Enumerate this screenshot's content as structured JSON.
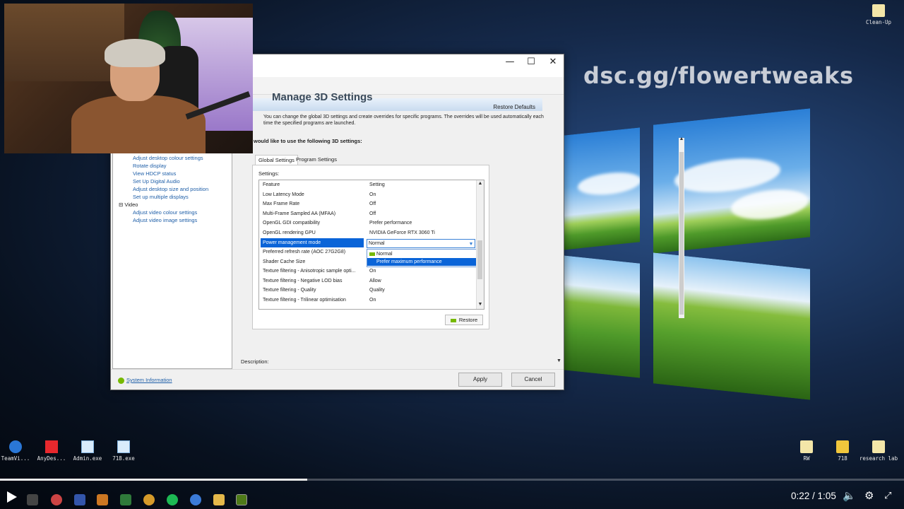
{
  "overlay": {
    "watermark": "dsc.gg/flowertweaks"
  },
  "window": {
    "accent": "#76b900"
  },
  "tree": {
    "items": [
      "Adjust desktop colour settings",
      "Rotate display",
      "View HDCP status",
      "Set Up Digital Audio",
      "Adjust desktop size and position",
      "Set up multiple displays",
      "Adjust video colour settings",
      "Adjust video image settings"
    ],
    "group_video": "Video"
  },
  "main": {
    "title": "Manage 3D Settings",
    "restore_defaults": "Restore Defaults",
    "intro": "You can change the global 3D settings and create overrides for specific programs. The overrides will be used automatically each time the specified programs are launched.",
    "section_heading": "would like to use the following 3D settings:",
    "tabs": [
      "Global Settings",
      "Program Settings"
    ],
    "settings_label": "Settings:",
    "restore_button": "Restore",
    "description_label": "Description:"
  },
  "grid": {
    "columns": [
      "Feature",
      "Setting"
    ],
    "rows": [
      {
        "feature": "Low Latency Mode",
        "setting": "On"
      },
      {
        "feature": "Max Frame Rate",
        "setting": "Off"
      },
      {
        "feature": "Multi-Frame Sampled AA (MFAA)",
        "setting": "Off"
      },
      {
        "feature": "OpenGL GDI compatibility",
        "setting": "Prefer performance"
      },
      {
        "feature": "OpenGL rendering GPU",
        "setting": "NVIDIA GeForce RTX 3060 Ti"
      },
      {
        "feature": "Power management mode",
        "setting": "Normal"
      },
      {
        "feature": "Preferred refresh rate (AOC 27G2G8)",
        "setting": ""
      },
      {
        "feature": "Shader Cache Size",
        "setting": ""
      },
      {
        "feature": "Texture filtering - Anisotropic sample opti...",
        "setting": "On"
      },
      {
        "feature": "Texture filtering - Negative LOD bias",
        "setting": "Allow"
      },
      {
        "feature": "Texture filtering - Quality",
        "setting": "Quality"
      },
      {
        "feature": "Texture filtering - Trilinear optimisation",
        "setting": "On"
      }
    ],
    "dropdown_options": [
      "Normal",
      "Prefer maximum performance"
    ],
    "selected_option": "Prefer maximum performance"
  },
  "footer": {
    "system_information": "System Information",
    "apply": "Apply",
    "cancel": "Cancel"
  },
  "desktop": {
    "icons": [
      "Clean-Up",
      "TeamVi...",
      "AnyDes...",
      "Admin.exe",
      "718.exe",
      "RW",
      "718",
      "research lab"
    ]
  },
  "player": {
    "current": "0:22",
    "duration": "1:05",
    "progress_fraction": 0.34
  }
}
